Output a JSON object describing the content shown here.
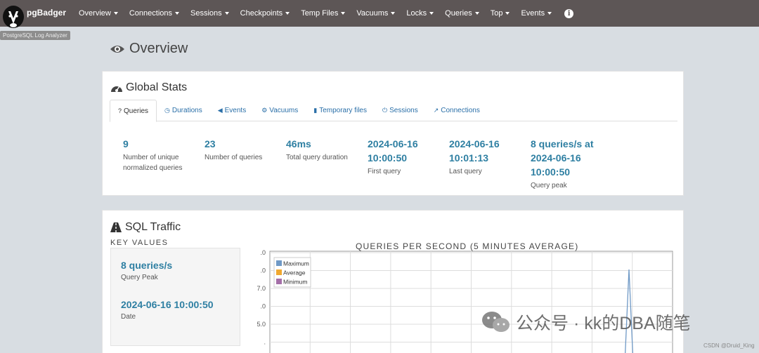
{
  "app": {
    "brand": "pgBadger",
    "tooltip": "PostgreSQL Log Analyzer"
  },
  "nav": [
    {
      "label": "Overview",
      "key": "overview"
    },
    {
      "label": "Connections",
      "key": "connections"
    },
    {
      "label": "Sessions",
      "key": "sessions"
    },
    {
      "label": "Checkpoints",
      "key": "checkpoints"
    },
    {
      "label": "Temp Files",
      "key": "temp-files"
    },
    {
      "label": "Vacuums",
      "key": "vacuums"
    },
    {
      "label": "Locks",
      "key": "locks"
    },
    {
      "label": "Queries",
      "key": "queries"
    },
    {
      "label": "Top",
      "key": "top"
    },
    {
      "label": "Events",
      "key": "events"
    }
  ],
  "page": {
    "title": "Overview"
  },
  "global_stats": {
    "title": "Global Stats",
    "tabs": [
      {
        "label": "Queries",
        "icon": "question-icon"
      },
      {
        "label": "Durations",
        "icon": "clock-icon"
      },
      {
        "label": "Events",
        "icon": "megaphone-icon"
      },
      {
        "label": "Vacuums",
        "icon": "cogs-icon"
      },
      {
        "label": "Temporary files",
        "icon": "file-icon"
      },
      {
        "label": "Sessions",
        "icon": "power-icon"
      },
      {
        "label": "Connections",
        "icon": "external-link-icon"
      }
    ],
    "stats": [
      {
        "value_lines": [
          "9"
        ],
        "label_lines": [
          "Number of unique",
          "normalized queries"
        ]
      },
      {
        "value_lines": [
          "23"
        ],
        "label_lines": [
          "Number of queries"
        ]
      },
      {
        "value_lines": [
          "46ms"
        ],
        "label_lines": [
          "Total query duration"
        ]
      },
      {
        "value_lines": [
          "2024-06-16",
          "10:00:50"
        ],
        "label_lines": [
          "First query"
        ]
      },
      {
        "value_lines": [
          "2024-06-16",
          "10:01:13"
        ],
        "label_lines": [
          "Last query"
        ]
      },
      {
        "value_lines": [
          "8 queries/s at",
          "2024-06-16",
          "10:00:50"
        ],
        "label_lines": [
          "Query peak"
        ]
      }
    ]
  },
  "sql_traffic": {
    "title": "SQL Traffic",
    "key_values_title": "KEY VALUES",
    "peak_value": "8 queries/s",
    "peak_label": "Query Peak",
    "date_value": "2024-06-16 10:00:50",
    "date_label": "Date"
  },
  "chart_data": {
    "type": "line",
    "title": "QUERIES PER SECOND (5 MINUTES AVERAGE)",
    "legend_position": "top-left",
    "grid": true,
    "y_tick_labels": [
      ".0",
      ".0",
      "7.0",
      ".0",
      "5.0",
      "."
    ],
    "ylim": [
      4,
      9
    ],
    "series": [
      {
        "name": "Maximum",
        "color": "#6f99c6"
      },
      {
        "name": "Average",
        "color": "#f0a830"
      },
      {
        "name": "Minimum",
        "color": "#a46fa8"
      }
    ],
    "peak": {
      "series": "Maximum",
      "y": 8
    }
  },
  "watermark": {
    "text": "公众号 · kk的DBA随笔",
    "csdn": "CSDN @Druid_King"
  }
}
